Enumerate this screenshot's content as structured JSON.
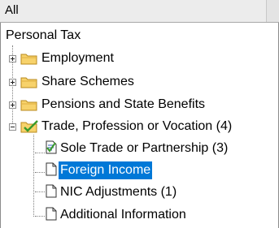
{
  "filter": {
    "value": "All"
  },
  "tree": {
    "root": "Personal Tax",
    "items": [
      {
        "label": "Employment",
        "state": "collapsed",
        "icon": "folder-icon"
      },
      {
        "label": "Share Schemes",
        "state": "collapsed",
        "icon": "folder-icon"
      },
      {
        "label": "Pensions and State Benefits",
        "state": "collapsed",
        "icon": "folder-icon"
      },
      {
        "label": "Trade, Profession or Vocation (4)",
        "state": "expanded",
        "icon": "folder-check-icon",
        "children": [
          {
            "label": "Sole Trade or Partnership (3)",
            "icon": "document-check-icon",
            "selected": false
          },
          {
            "label": "Foreign Income",
            "icon": "document-icon",
            "selected": true
          },
          {
            "label": "NIC Adjustments (1)",
            "icon": "document-icon",
            "selected": false
          },
          {
            "label": "Additional Information",
            "icon": "document-icon",
            "selected": false
          }
        ]
      }
    ]
  },
  "colors": {
    "selection": "#0078d7",
    "folder": "#f7d26b",
    "check": "#3a9a2a"
  }
}
